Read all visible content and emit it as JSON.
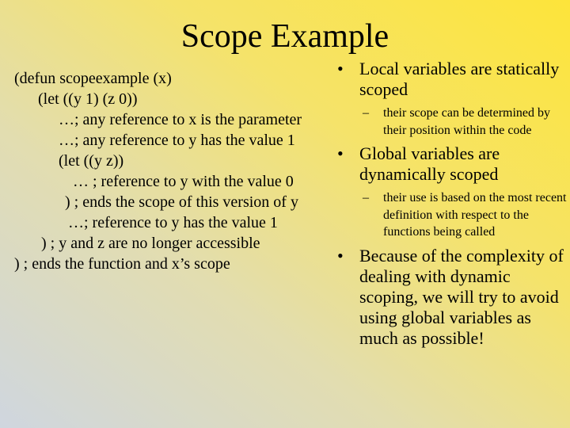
{
  "slide": {
    "title": "Scope Example",
    "code_lines": [
      "(defun scopeexample (x)",
      "(let ((y 1) (z 0))",
      "…; any reference to x is the parameter",
      "…; any reference to y has the value 1",
      "(let ((y z))",
      "… ; reference to y with the value 0",
      ") ; ends the scope of this version of y",
      "…; reference to y has the value 1",
      ") ; y and z are no longer accessible",
      ") ; ends the function and x’s scope"
    ],
    "bullets": [
      {
        "marker": "•",
        "text": "Local variables are statically scoped",
        "sub": {
          "marker": "–",
          "text": "their scope can be determined by their position within the code"
        }
      },
      {
        "marker": "•",
        "text": "Global variables are dynamically scoped",
        "sub": {
          "marker": "–",
          "text": "their use is based on the most recent definition with respect to the functions being called"
        }
      },
      {
        "marker": "•",
        "text": "Because of the complexity of dealing with dynamic scoping, we will try to avoid using global variables as much as possible!"
      }
    ]
  }
}
